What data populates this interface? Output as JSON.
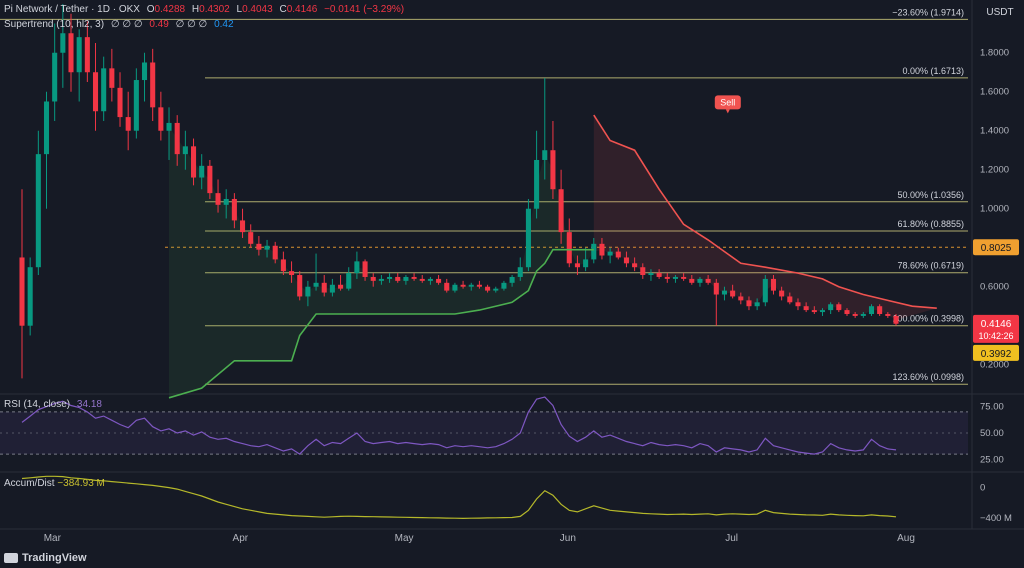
{
  "legend": {
    "symbol": "Pi Network / Tether · 1D · OKX",
    "open_label": "O",
    "open": "0.4288",
    "high_label": "H",
    "high": "0.4302",
    "low_label": "L",
    "low": "0.4043",
    "close_label": "C",
    "close": "0.4146",
    "change": "−0.0141 (−3.29%)",
    "supertrend_label": "Supertrend (10, hl2, 3)",
    "supertrend_empty": "∅ ∅ ∅",
    "supertrend_red": "0.49",
    "supertrend_empty2": "∅ ∅ ∅",
    "supertrend_blue": "0.42",
    "rsi_label": "RSI (14, close)",
    "rsi_value": "34.18",
    "ad_label": "Accum/Dist",
    "ad_value": "−384.93 M"
  },
  "currency": "USDT",
  "branding": "TradingView",
  "colors": {
    "up": "#089981",
    "down": "#f23645",
    "st_up": "#4caf50",
    "st_down": "#f05350",
    "fib": "#c9c57a",
    "rsi": "#7e57c2",
    "ad": "#b5b82a",
    "bg": "#161a25",
    "text": "#d1d4dc"
  },
  "chart_data": {
    "type": "candlestick",
    "x_ticks": [
      "Mar",
      "Apr",
      "May",
      "Jun",
      "Jul",
      "Aug"
    ],
    "y_ticks": [
      "0.2000",
      "0.4000",
      "0.6000",
      "0.8000",
      "1.0000",
      "1.2000",
      "1.4000",
      "1.6000",
      "1.8000"
    ],
    "ylim": [
      0.06,
      2.05
    ],
    "fib_levels": [
      {
        "label": "−23.60% (1.9714)",
        "value": 1.9714
      },
      {
        "label": "0.00% (1.6713)",
        "value": 1.6713
      },
      {
        "label": "50.00% (1.0356)",
        "value": 1.0356
      },
      {
        "label": "61.80% (0.8855)",
        "value": 0.8855
      },
      {
        "label": "78.60% (0.6719)",
        "value": 0.6719
      },
      {
        "label": "100.00% (0.3998)",
        "value": 0.3998
      },
      {
        "label": "123.60% (0.0998)",
        "value": 0.0998
      }
    ],
    "price_tags": [
      {
        "label": "0.8025",
        "value": 0.8025
      },
      {
        "label": "0.4146",
        "value": 0.4146
      },
      {
        "label": "10:42:26",
        "value": 0.4146
      },
      {
        "label": "0.3992",
        "value": 0.3992
      }
    ],
    "signal": {
      "label": "Sell",
      "date_index": 88
    },
    "candles": [
      [
        0.75,
        1.1,
        0.13,
        0.4
      ],
      [
        0.4,
        0.75,
        0.35,
        0.7
      ],
      [
        0.7,
        1.4,
        0.66,
        1.28
      ],
      [
        1.28,
        1.6,
        1.0,
        1.55
      ],
      [
        1.55,
        1.95,
        1.45,
        1.8
      ],
      [
        1.8,
        2.05,
        1.62,
        1.9
      ],
      [
        1.9,
        2.0,
        1.6,
        1.7
      ],
      [
        1.7,
        1.92,
        1.55,
        1.88
      ],
      [
        1.88,
        1.96,
        1.65,
        1.7
      ],
      [
        1.7,
        1.85,
        1.4,
        1.5
      ],
      [
        1.5,
        1.78,
        1.45,
        1.72
      ],
      [
        1.72,
        1.82,
        1.55,
        1.62
      ],
      [
        1.62,
        1.7,
        1.42,
        1.47
      ],
      [
        1.47,
        1.6,
        1.3,
        1.4
      ],
      [
        1.4,
        1.72,
        1.36,
        1.66
      ],
      [
        1.66,
        1.8,
        1.55,
        1.75
      ],
      [
        1.75,
        1.82,
        1.45,
        1.52
      ],
      [
        1.52,
        1.6,
        1.35,
        1.4
      ],
      [
        1.4,
        1.52,
        1.25,
        1.44
      ],
      [
        1.44,
        1.48,
        1.22,
        1.28
      ],
      [
        1.28,
        1.4,
        1.2,
        1.32
      ],
      [
        1.32,
        1.36,
        1.12,
        1.16
      ],
      [
        1.16,
        1.28,
        1.1,
        1.22
      ],
      [
        1.22,
        1.25,
        1.05,
        1.08
      ],
      [
        1.08,
        1.15,
        0.98,
        1.02
      ],
      [
        1.02,
        1.1,
        0.95,
        1.05
      ],
      [
        1.05,
        1.08,
        0.9,
        0.94
      ],
      [
        0.94,
        1.0,
        0.85,
        0.88
      ],
      [
        0.88,
        0.92,
        0.8,
        0.82
      ],
      [
        0.82,
        0.86,
        0.76,
        0.79
      ],
      [
        0.79,
        0.84,
        0.75,
        0.81
      ],
      [
        0.81,
        0.83,
        0.72,
        0.74
      ],
      [
        0.74,
        0.78,
        0.66,
        0.68
      ],
      [
        0.68,
        0.73,
        0.62,
        0.66
      ],
      [
        0.66,
        0.68,
        0.53,
        0.55
      ],
      [
        0.55,
        0.63,
        0.5,
        0.6
      ],
      [
        0.6,
        0.77,
        0.58,
        0.62
      ],
      [
        0.62,
        0.66,
        0.55,
        0.57
      ],
      [
        0.57,
        0.64,
        0.55,
        0.61
      ],
      [
        0.61,
        0.66,
        0.58,
        0.59
      ],
      [
        0.59,
        0.7,
        0.58,
        0.67
      ],
      [
        0.67,
        0.78,
        0.64,
        0.73
      ],
      [
        0.73,
        0.74,
        0.63,
        0.65
      ],
      [
        0.65,
        0.67,
        0.6,
        0.63
      ],
      [
        0.63,
        0.66,
        0.61,
        0.64
      ],
      [
        0.64,
        0.67,
        0.62,
        0.65
      ],
      [
        0.65,
        0.67,
        0.62,
        0.63
      ],
      [
        0.63,
        0.66,
        0.61,
        0.65
      ],
      [
        0.65,
        0.67,
        0.63,
        0.64
      ],
      [
        0.64,
        0.66,
        0.62,
        0.63
      ],
      [
        0.63,
        0.65,
        0.61,
        0.64
      ],
      [
        0.64,
        0.66,
        0.61,
        0.62
      ],
      [
        0.62,
        0.64,
        0.57,
        0.58
      ],
      [
        0.58,
        0.62,
        0.57,
        0.61
      ],
      [
        0.61,
        0.63,
        0.59,
        0.6
      ],
      [
        0.6,
        0.62,
        0.58,
        0.61
      ],
      [
        0.61,
        0.63,
        0.59,
        0.6
      ],
      [
        0.6,
        0.61,
        0.57,
        0.58
      ],
      [
        0.58,
        0.6,
        0.57,
        0.59
      ],
      [
        0.59,
        0.63,
        0.58,
        0.62
      ],
      [
        0.62,
        0.66,
        0.6,
        0.65
      ],
      [
        0.65,
        0.75,
        0.63,
        0.7
      ],
      [
        0.7,
        1.05,
        0.68,
        1.0
      ],
      [
        1.0,
        1.4,
        0.95,
        1.25
      ],
      [
        1.25,
        1.67,
        1.15,
        1.3
      ],
      [
        1.3,
        1.45,
        1.05,
        1.1
      ],
      [
        1.1,
        1.2,
        0.82,
        0.88
      ],
      [
        0.88,
        0.95,
        0.7,
        0.72
      ],
      [
        0.72,
        0.76,
        0.66,
        0.7
      ],
      [
        0.7,
        0.8,
        0.68,
        0.74
      ],
      [
        0.74,
        0.85,
        0.72,
        0.82
      ],
      [
        0.82,
        0.85,
        0.74,
        0.76
      ],
      [
        0.76,
        0.8,
        0.72,
        0.78
      ],
      [
        0.78,
        0.8,
        0.74,
        0.75
      ],
      [
        0.75,
        0.78,
        0.7,
        0.72
      ],
      [
        0.72,
        0.75,
        0.68,
        0.7
      ],
      [
        0.7,
        0.72,
        0.64,
        0.66
      ],
      [
        0.66,
        0.69,
        0.63,
        0.67
      ],
      [
        0.67,
        0.69,
        0.64,
        0.65
      ],
      [
        0.65,
        0.67,
        0.62,
        0.64
      ],
      [
        0.64,
        0.66,
        0.62,
        0.65
      ],
      [
        0.65,
        0.67,
        0.63,
        0.64
      ],
      [
        0.64,
        0.66,
        0.61,
        0.62
      ],
      [
        0.62,
        0.65,
        0.6,
        0.64
      ],
      [
        0.64,
        0.66,
        0.61,
        0.62
      ],
      [
        0.62,
        0.64,
        0.4,
        0.56
      ],
      [
        0.56,
        0.6,
        0.53,
        0.58
      ],
      [
        0.58,
        0.61,
        0.54,
        0.55
      ],
      [
        0.55,
        0.57,
        0.51,
        0.53
      ],
      [
        0.53,
        0.55,
        0.48,
        0.5
      ],
      [
        0.5,
        0.54,
        0.48,
        0.52
      ],
      [
        0.52,
        0.66,
        0.5,
        0.64
      ],
      [
        0.64,
        0.66,
        0.56,
        0.58
      ],
      [
        0.58,
        0.6,
        0.53,
        0.55
      ],
      [
        0.55,
        0.57,
        0.51,
        0.52
      ],
      [
        0.52,
        0.54,
        0.48,
        0.5
      ],
      [
        0.5,
        0.52,
        0.47,
        0.48
      ],
      [
        0.48,
        0.5,
        0.46,
        0.47
      ],
      [
        0.47,
        0.49,
        0.45,
        0.48
      ],
      [
        0.48,
        0.52,
        0.46,
        0.51
      ],
      [
        0.51,
        0.52,
        0.47,
        0.48
      ],
      [
        0.48,
        0.49,
        0.45,
        0.46
      ],
      [
        0.46,
        0.47,
        0.44,
        0.45
      ],
      [
        0.45,
        0.47,
        0.44,
        0.46
      ],
      [
        0.46,
        0.51,
        0.45,
        0.5
      ],
      [
        0.5,
        0.51,
        0.45,
        0.46
      ],
      [
        0.46,
        0.47,
        0.44,
        0.45
      ],
      [
        0.45,
        0.46,
        0.4,
        0.41
      ]
    ],
    "supertrend": {
      "up_segments": [
        {
          "start": 18,
          "end": 63,
          "points": [
            [
              18,
              0.03
            ],
            [
              22,
              0.08
            ],
            [
              26,
              0.22
            ],
            [
              33,
              0.22
            ],
            [
              34,
              0.35
            ],
            [
              36,
              0.46
            ],
            [
              49,
              0.46
            ],
            [
              53,
              0.46
            ],
            [
              56,
              0.48
            ],
            [
              60,
              0.52
            ],
            [
              62,
              0.58
            ],
            [
              63,
              0.68
            ],
            [
              64,
              0.72
            ],
            [
              65,
              0.79
            ],
            [
              70,
              0.79
            ]
          ]
        }
      ],
      "down_points": [
        [
          70,
          1.48
        ],
        [
          72,
          1.35
        ],
        [
          75,
          1.3
        ],
        [
          78,
          1.1
        ],
        [
          81,
          0.92
        ],
        [
          84,
          0.84
        ],
        [
          86,
          0.78
        ],
        [
          88,
          0.72
        ],
        [
          91,
          0.7
        ],
        [
          95,
          0.67
        ],
        [
          98,
          0.64
        ],
        [
          100,
          0.6
        ],
        [
          103,
          0.56
        ],
        [
          106,
          0.53
        ],
        [
          109,
          0.5
        ],
        [
          112,
          0.49
        ]
      ]
    },
    "rsi": {
      "label": "RSI (14, close)",
      "ylim": [
        15,
        85
      ],
      "y_ticks": [
        "25.00",
        "50.00",
        "75.00"
      ],
      "band_upper": 70,
      "band_lower": 30,
      "values": [
        60,
        66,
        72,
        75,
        78,
        80,
        76,
        74,
        70,
        64,
        66,
        62,
        58,
        55,
        62,
        64,
        56,
        52,
        54,
        50,
        52,
        48,
        51,
        46,
        44,
        45,
        42,
        40,
        38,
        37,
        39,
        36,
        33,
        35,
        30,
        38,
        44,
        38,
        41,
        40,
        45,
        50,
        42,
        40,
        41,
        42,
        40,
        41,
        40,
        39,
        40,
        39,
        36,
        38,
        37,
        38,
        37,
        36,
        37,
        40,
        44,
        50,
        70,
        82,
        84,
        76,
        58,
        47,
        42,
        46,
        52,
        46,
        48,
        45,
        42,
        40,
        38,
        41,
        39,
        38,
        39,
        38,
        36,
        40,
        38,
        32,
        36,
        35,
        34,
        32,
        34,
        45,
        38,
        36,
        34,
        32,
        31,
        30,
        32,
        40,
        36,
        34,
        33,
        34,
        44,
        38,
        35,
        34
      ],
      "color": "#7e57c2"
    },
    "accum_dist": {
      "label": "Accum/Dist",
      "ylim": [
        -520,
        180
      ],
      "y_ticks": [
        "0",
        "−400 M"
      ],
      "values": [
        120,
        130,
        140,
        150,
        150,
        145,
        130,
        120,
        110,
        95,
        90,
        80,
        70,
        60,
        50,
        40,
        30,
        15,
        0,
        -20,
        -50,
        -80,
        -110,
        -150,
        -190,
        -220,
        -250,
        -280,
        -300,
        -320,
        -340,
        -350,
        -360,
        -370,
        -375,
        -380,
        -385,
        -390,
        -385,
        -380,
        -378,
        -380,
        -382,
        -384,
        -386,
        -388,
        -390,
        -392,
        -394,
        -396,
        -398,
        -400,
        -402,
        -404,
        -406,
        -404,
        -402,
        -400,
        -398,
        -396,
        -394,
        -380,
        -300,
        -150,
        -40,
        -100,
        -220,
        -300,
        -320,
        -280,
        -240,
        -270,
        -300,
        -310,
        -320,
        -330,
        -340,
        -345,
        -350,
        -355,
        -352,
        -350,
        -355,
        -350,
        -345,
        -360,
        -350,
        -345,
        -350,
        -355,
        -350,
        -300,
        -330,
        -340,
        -350,
        -355,
        -360,
        -362,
        -365,
        -350,
        -360,
        -365,
        -370,
        -372,
        -360,
        -370,
        -375,
        -385
      ],
      "color": "#b5b82a"
    }
  }
}
